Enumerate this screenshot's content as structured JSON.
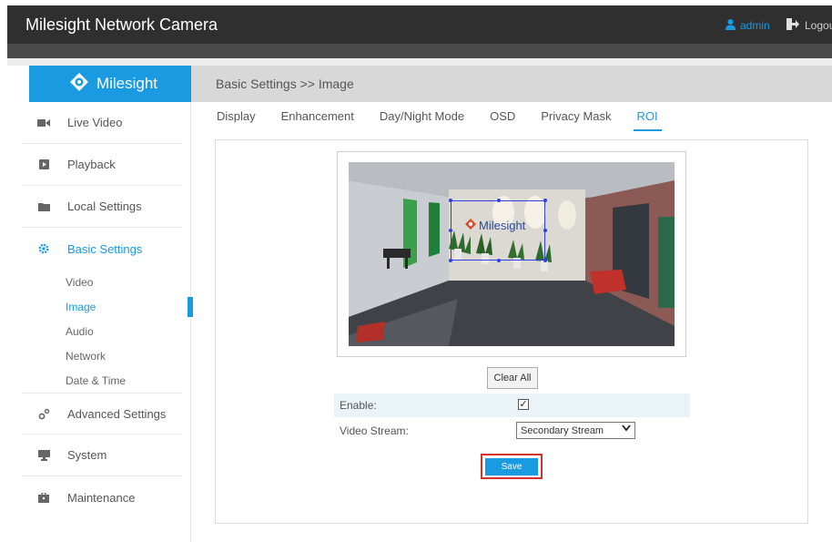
{
  "app": {
    "title": "Milesight Network Camera",
    "user": "admin",
    "logout": "Logout"
  },
  "brand": {
    "name": "Milesight"
  },
  "breadcrumb": "Basic Settings >> Image",
  "sidebar": {
    "items": [
      {
        "label": "Live Video",
        "icon": "video-camera-icon"
      },
      {
        "label": "Playback",
        "icon": "play-icon"
      },
      {
        "label": "Local Settings",
        "icon": "folder-icon"
      },
      {
        "label": "Basic Settings",
        "icon": "gear-icon"
      },
      {
        "label": "Advanced Settings",
        "icon": "gears-icon"
      },
      {
        "label": "System",
        "icon": "monitor-icon"
      },
      {
        "label": "Maintenance",
        "icon": "toolbox-icon"
      }
    ],
    "sub_items": [
      {
        "label": "Video"
      },
      {
        "label": "Image"
      },
      {
        "label": "Audio"
      },
      {
        "label": "Network"
      },
      {
        "label": "Date & Time"
      }
    ]
  },
  "tabs": [
    {
      "label": "Display"
    },
    {
      "label": "Enhancement"
    },
    {
      "label": "Day/Night Mode"
    },
    {
      "label": "OSD"
    },
    {
      "label": "Privacy Mask"
    },
    {
      "label": "ROI"
    }
  ],
  "preview": {
    "logo_text": "Milesight"
  },
  "roi": {
    "clear_label": "Clear All"
  },
  "form": {
    "enable_label": "Enable:",
    "enable_checked": true,
    "enable_check_glyph": "✓",
    "stream_label": "Video Stream:",
    "stream_value": "Secondary Stream"
  },
  "save_label": "Save",
  "colors": {
    "accent": "#1a9ae0",
    "topbar": "#2f2f2f",
    "highlight": "#d9322b",
    "roi": "#2f3fe6"
  }
}
